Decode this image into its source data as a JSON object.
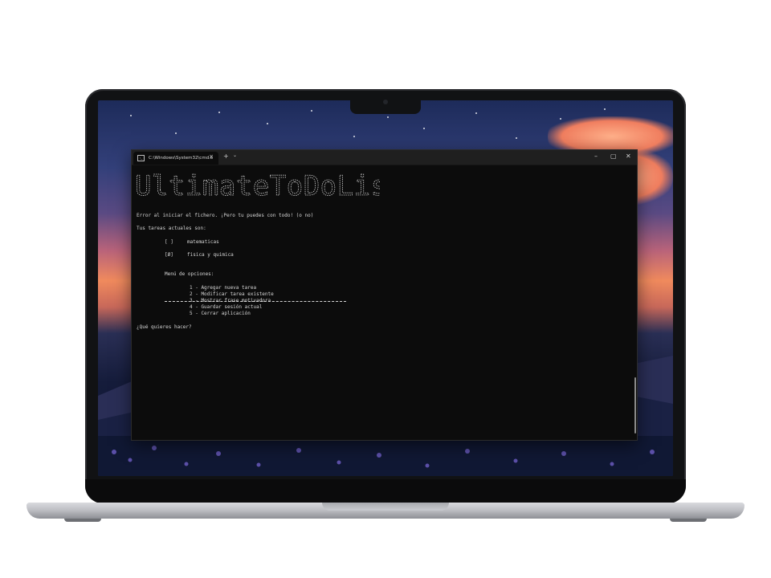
{
  "terminal": {
    "tab_title": "C:\\Windows\\System32\\cmd.e",
    "tab_close": "×",
    "new_tab": "+",
    "tab_dropdown": "⌄",
    "minimize": "–",
    "maximize": "▢",
    "close": "✕",
    "banner_text": "UltimateToDoList",
    "error_line": "Error al iniciar el fichero. ¡Pero tu puedes con todo! (o no)",
    "tasks_header": "Tus tareas actuales son:",
    "tasks": [
      {
        "check": "[ ]",
        "name": "matematicas"
      },
      {
        "check": "[Ø]",
        "name": "fisica y quimica"
      }
    ],
    "menu_title": "Menú de opciones:",
    "menu_items": [
      "1 - Agregar nueva tarea",
      "2 - Modificar tarea existente",
      "3 - Mostrar frase motivadora",
      "4 - Guardar sesión actual",
      "5 - Cerrar aplicación"
    ],
    "prompt": "¿Qué quieres hacer?"
  },
  "colors": {
    "terminal_bg": "#0c0c0c",
    "terminal_text": "#d7d7d7",
    "titlebar_bg": "#1f1f1f"
  }
}
